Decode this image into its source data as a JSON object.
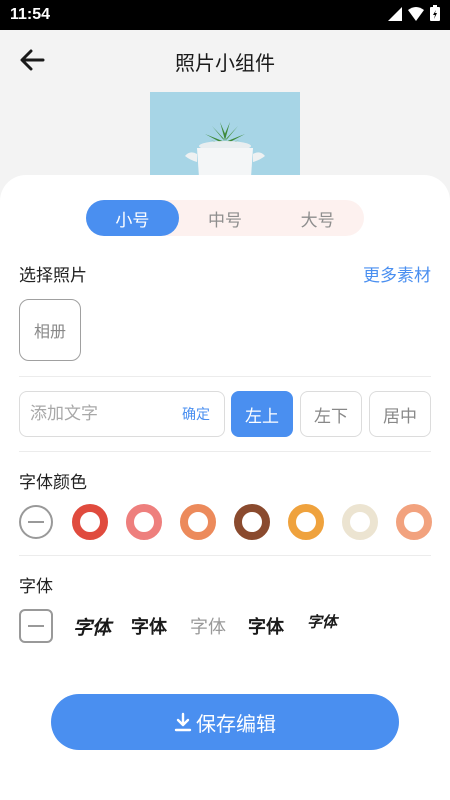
{
  "status_bar": {
    "time": "11:54"
  },
  "header": {
    "title": "照片小组件"
  },
  "size_tabs": [
    {
      "label": "小号",
      "active": true
    },
    {
      "label": "中号",
      "active": false
    },
    {
      "label": "大号",
      "active": false
    }
  ],
  "photo": {
    "label": "选择照片",
    "more_label": "更多素材",
    "album_label": "相册"
  },
  "text": {
    "placeholder": "添加文字",
    "confirm_label": "确定"
  },
  "positions": [
    {
      "label": "左上",
      "active": true
    },
    {
      "label": "左下",
      "active": false
    },
    {
      "label": "居中",
      "active": false
    }
  ],
  "font_color": {
    "label": "字体颜色",
    "swatches": [
      "#e04b3e",
      "#ee7f7d",
      "#ec8a5b",
      "#8a4a2e",
      "#efa23d",
      "#ece4d1",
      "#f2a27e"
    ]
  },
  "font": {
    "label": "字体",
    "options": [
      "字体",
      "字体",
      "字体",
      "字体",
      "字体"
    ]
  },
  "save": {
    "label": "保存编辑"
  },
  "colors": {
    "accent": "#4a8ff0",
    "tab_bg": "#fdf1ef"
  }
}
